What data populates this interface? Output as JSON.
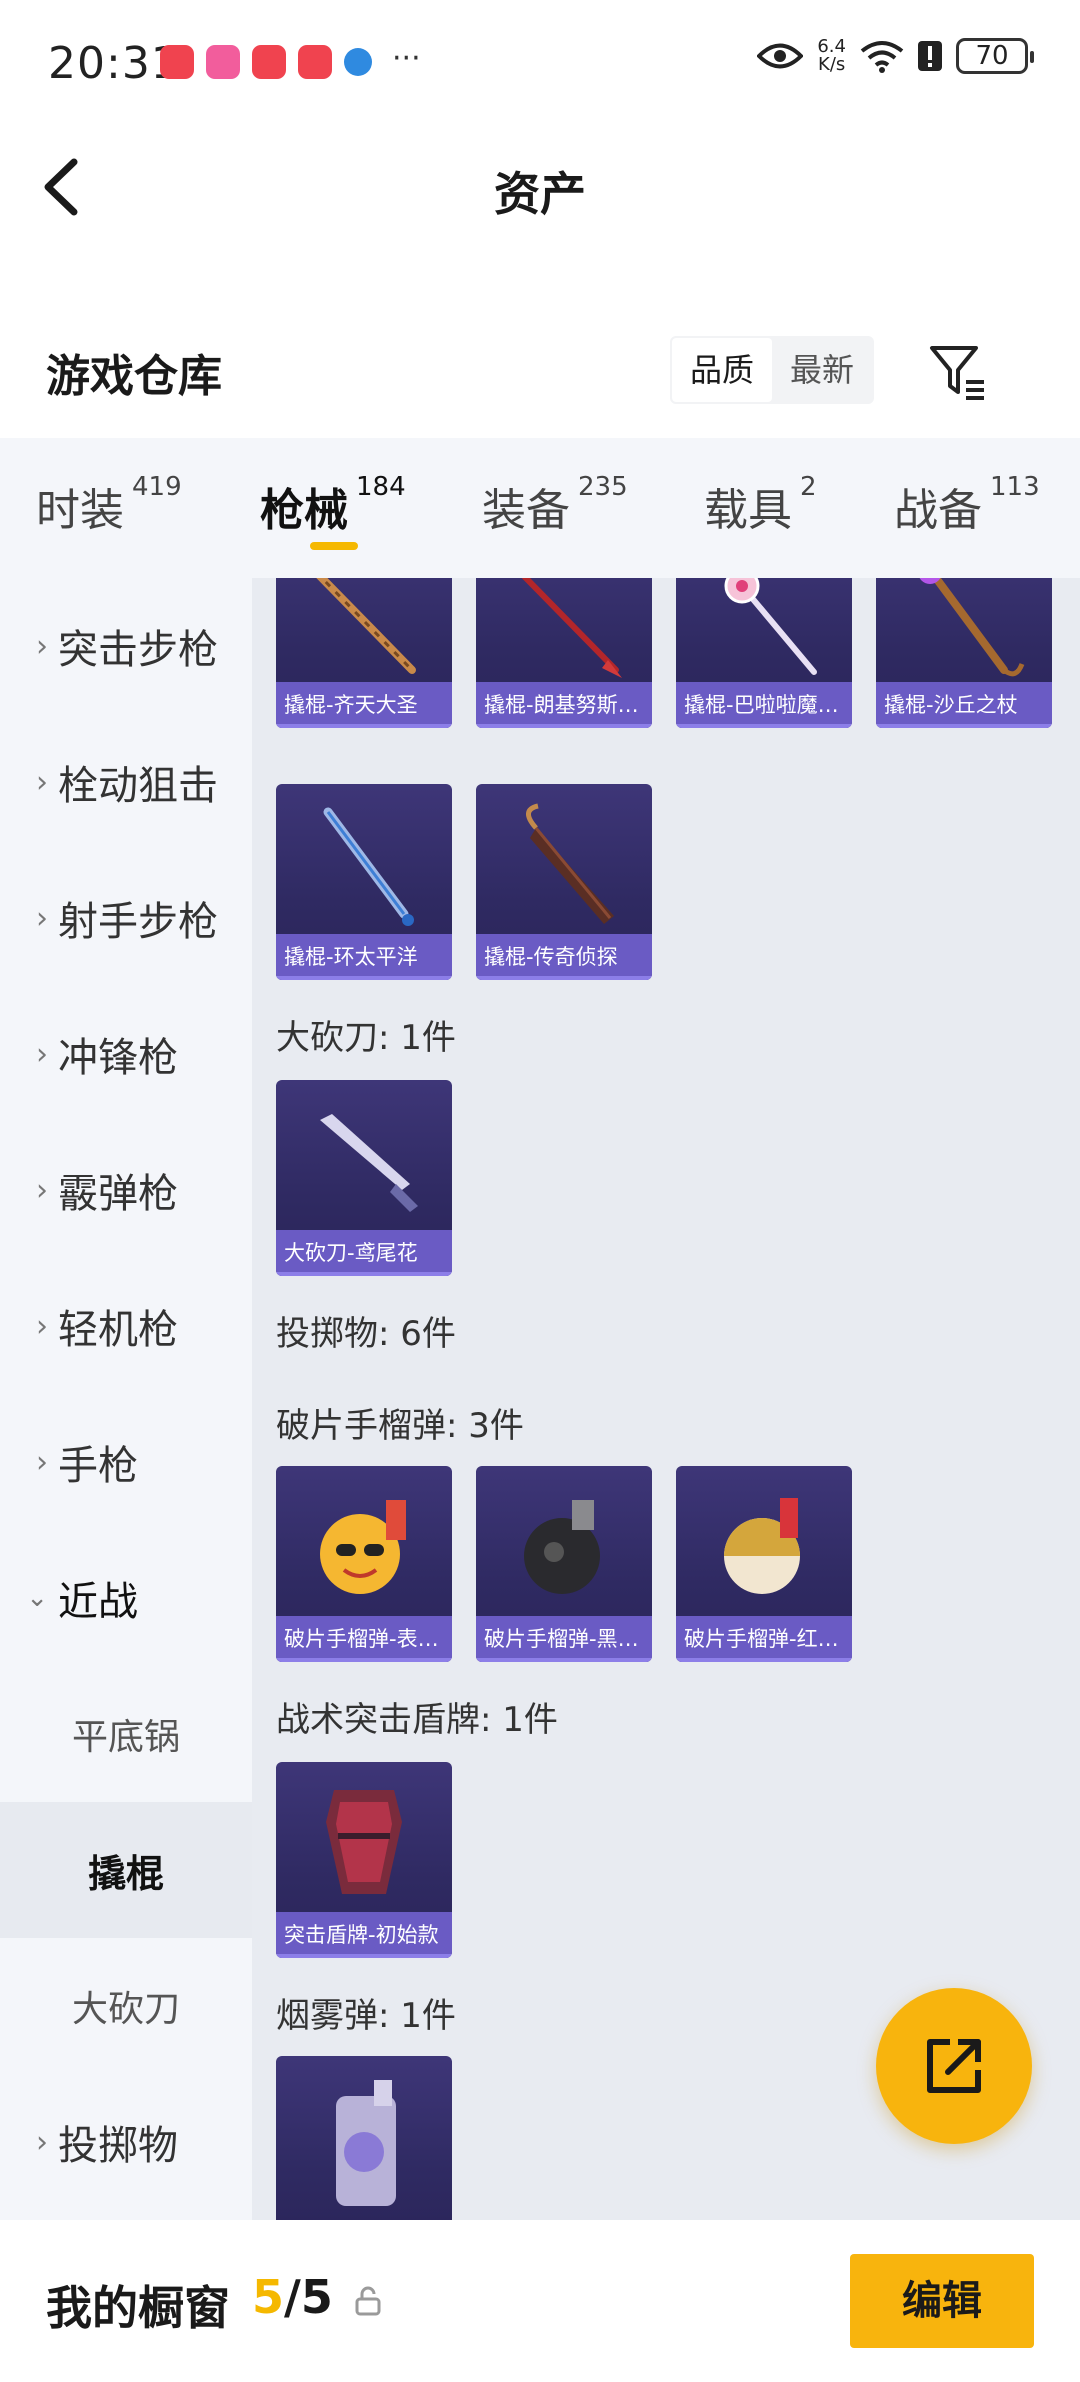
{
  "status_bar": {
    "time": "20:31",
    "network_speed_value": "6.4",
    "network_speed_unit": "K/s",
    "battery": "70",
    "more": "···"
  },
  "nav": {
    "title": "资产"
  },
  "section": {
    "title": "游戏仓库",
    "sort_options": [
      "品质",
      "最新"
    ],
    "sort_active": "品质"
  },
  "tabs": [
    {
      "label": "时装",
      "count": "419"
    },
    {
      "label": "枪械",
      "count": "184",
      "active": true
    },
    {
      "label": "装备",
      "count": "235"
    },
    {
      "label": "载具",
      "count": "2"
    },
    {
      "label": "战备",
      "count": "113"
    }
  ],
  "sidebar": {
    "items": [
      {
        "label": "突击步枪"
      },
      {
        "label": "栓动狙击"
      },
      {
        "label": "射手步枪"
      },
      {
        "label": "冲锋枪"
      },
      {
        "label": "霰弹枪"
      },
      {
        "label": "轻机枪"
      },
      {
        "label": "手枪"
      },
      {
        "label": "近战",
        "expanded": true
      },
      {
        "label": "投掷物"
      }
    ],
    "sub_items": [
      {
        "label": "平底锅"
      },
      {
        "label": "撬棍",
        "active": true
      },
      {
        "label": "大砍刀"
      }
    ]
  },
  "content": {
    "crowbar_items": [
      "撬棍-齐天大圣",
      "撬棍-朗基努斯之枪",
      "撬棍-巴啦啦魔法棒",
      "撬棍-沙丘之杖",
      "撬棍-环太平洋",
      "撬棍-传奇侦探"
    ],
    "machete_header": "大砍刀: 1件",
    "machete_items": [
      "大砍刀-鸢尾花"
    ],
    "throwables_header": "投掷物: 6件",
    "frag_header": "破片手榴弹: 3件",
    "frag_items": [
      "破片手榴弹-表情包",
      "破片手榴弹-黑色款",
      "破片手榴弹-红白款"
    ],
    "shield_header": "战术突击盾牌: 1件",
    "shield_items": [
      "突击盾牌-初始款"
    ],
    "smoke_header": "烟雾弹: 1件"
  },
  "bottom_bar": {
    "label": "我的橱窗",
    "count_current": "5",
    "count_sep_total": "/5",
    "edit_label": "编辑"
  },
  "colors": {
    "accent": "#f8b40d",
    "card_bg": "#2f2a62",
    "card_caption": "#6a5bc4",
    "content_bg": "#e8ebf1",
    "sidebar_bg": "#f4f6fa"
  }
}
